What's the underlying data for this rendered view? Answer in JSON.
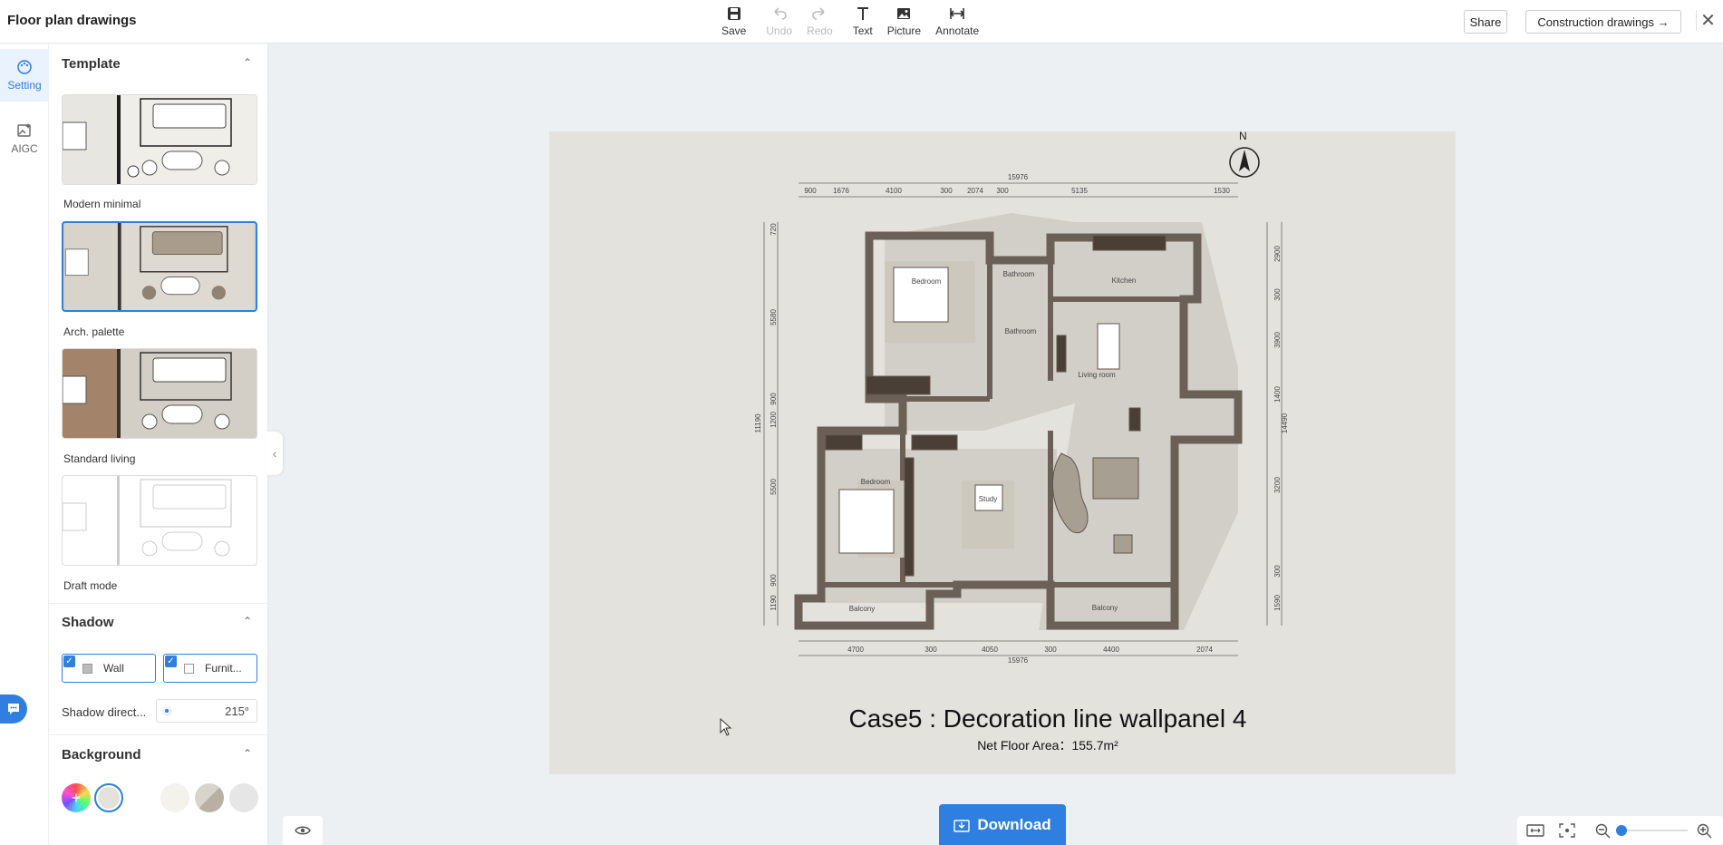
{
  "app": {
    "title": "Floor plan drawings"
  },
  "toolbar": {
    "save": "Save",
    "undo": "Undo",
    "redo": "Redo",
    "text": "Text",
    "picture": "Picture",
    "annotate": "Annotate"
  },
  "header": {
    "share": "Share",
    "construction": "Construction drawings →",
    "close_icon": "✕"
  },
  "rail": [
    {
      "label": "Setting",
      "icon": "palette-icon",
      "active": true
    },
    {
      "label": "AIGC",
      "icon": "image-ai-icon",
      "active": false
    }
  ],
  "template": {
    "title": "Template",
    "items": [
      {
        "label": "Modern minimal",
        "selected": false
      },
      {
        "label": "Arch. palette",
        "selected": true
      },
      {
        "label": "Standard living",
        "selected": false
      },
      {
        "label": "Draft mode",
        "selected": false
      }
    ]
  },
  "shadow": {
    "title": "Shadow",
    "wall": "Wall",
    "furniture": "Furnit...",
    "direction_label": "Shadow direct...",
    "direction_value": "215°"
  },
  "background": {
    "title": "Background",
    "colors": [
      "#e4e2dd",
      "#f4f2ec",
      "#d8d4cb",
      "#e6e6e6"
    ],
    "selected_index": 0
  },
  "plan": {
    "title": "Case5 : Decoration line wallpanel 4",
    "area": "Net Floor Area：155.7m²",
    "north": "N",
    "top_dims": [
      "900",
      "1676",
      "4100",
      "300",
      "2074",
      "300",
      "5135",
      "1530"
    ],
    "bottom_dims": [
      "4700",
      "300",
      "4050",
      "300",
      "4400",
      "2074"
    ],
    "left_dims": [
      "720",
      "5580",
      "900",
      "1200",
      "5500",
      "900",
      "1190"
    ],
    "right_dims": [
      "2900",
      "300",
      "3900",
      "1400",
      "3200",
      "300",
      "1590"
    ],
    "total_top": "15976",
    "total_bottom": "15976",
    "total_left": "11190",
    "total_right": "14490",
    "rooms": [
      "Kitchen",
      "Bathroom",
      "Bedroom",
      "Bathroom",
      "Living room",
      "Bedroom",
      "Study",
      "Balcony",
      "Balcony"
    ]
  },
  "download": {
    "label": "Download"
  }
}
